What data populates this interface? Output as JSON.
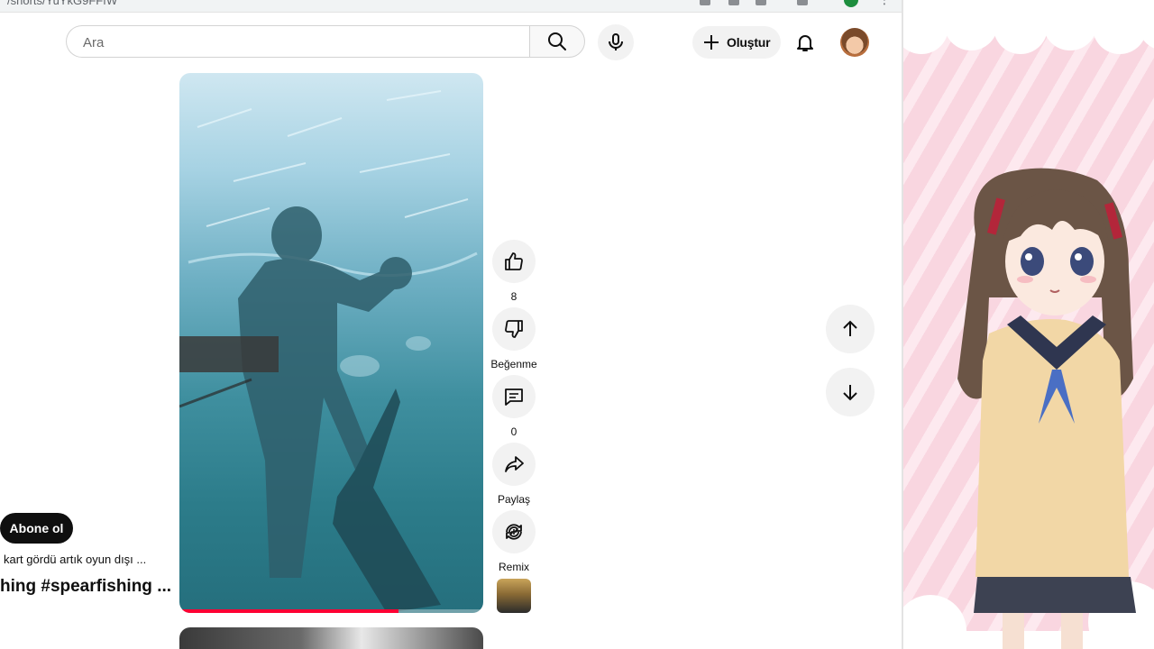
{
  "browser": {
    "url_fragment": "/shorts/YuYkG9FFfW"
  },
  "header": {
    "search_placeholder": "Ara",
    "create_label": "Oluştur"
  },
  "video": {
    "progress": 0.72
  },
  "channel": {
    "subscribe_label": "Abone ol"
  },
  "video_meta": {
    "description": "kart gördü artık oyun dışı ...",
    "title": "hing #spearfishing ..."
  },
  "actions": {
    "like_count": "8",
    "dislike_label": "Beğenme",
    "comment_count": "0",
    "share_label": "Paylaş",
    "remix_label": "Remix"
  },
  "icons": {
    "search": "search-icon",
    "mic": "mic-icon",
    "create": "plus-icon",
    "bell": "bell-icon",
    "like": "thumbs-up-icon",
    "dislike": "thumbs-down-icon",
    "comment": "comment-icon",
    "share": "share-icon",
    "remix": "remix-icon",
    "up": "arrow-up-icon",
    "down": "arrow-down-icon"
  },
  "colors": {
    "subscribe_bg": "#0f0f0f",
    "progress": "#ff0033",
    "panel_pink": "#f9d6e0"
  }
}
